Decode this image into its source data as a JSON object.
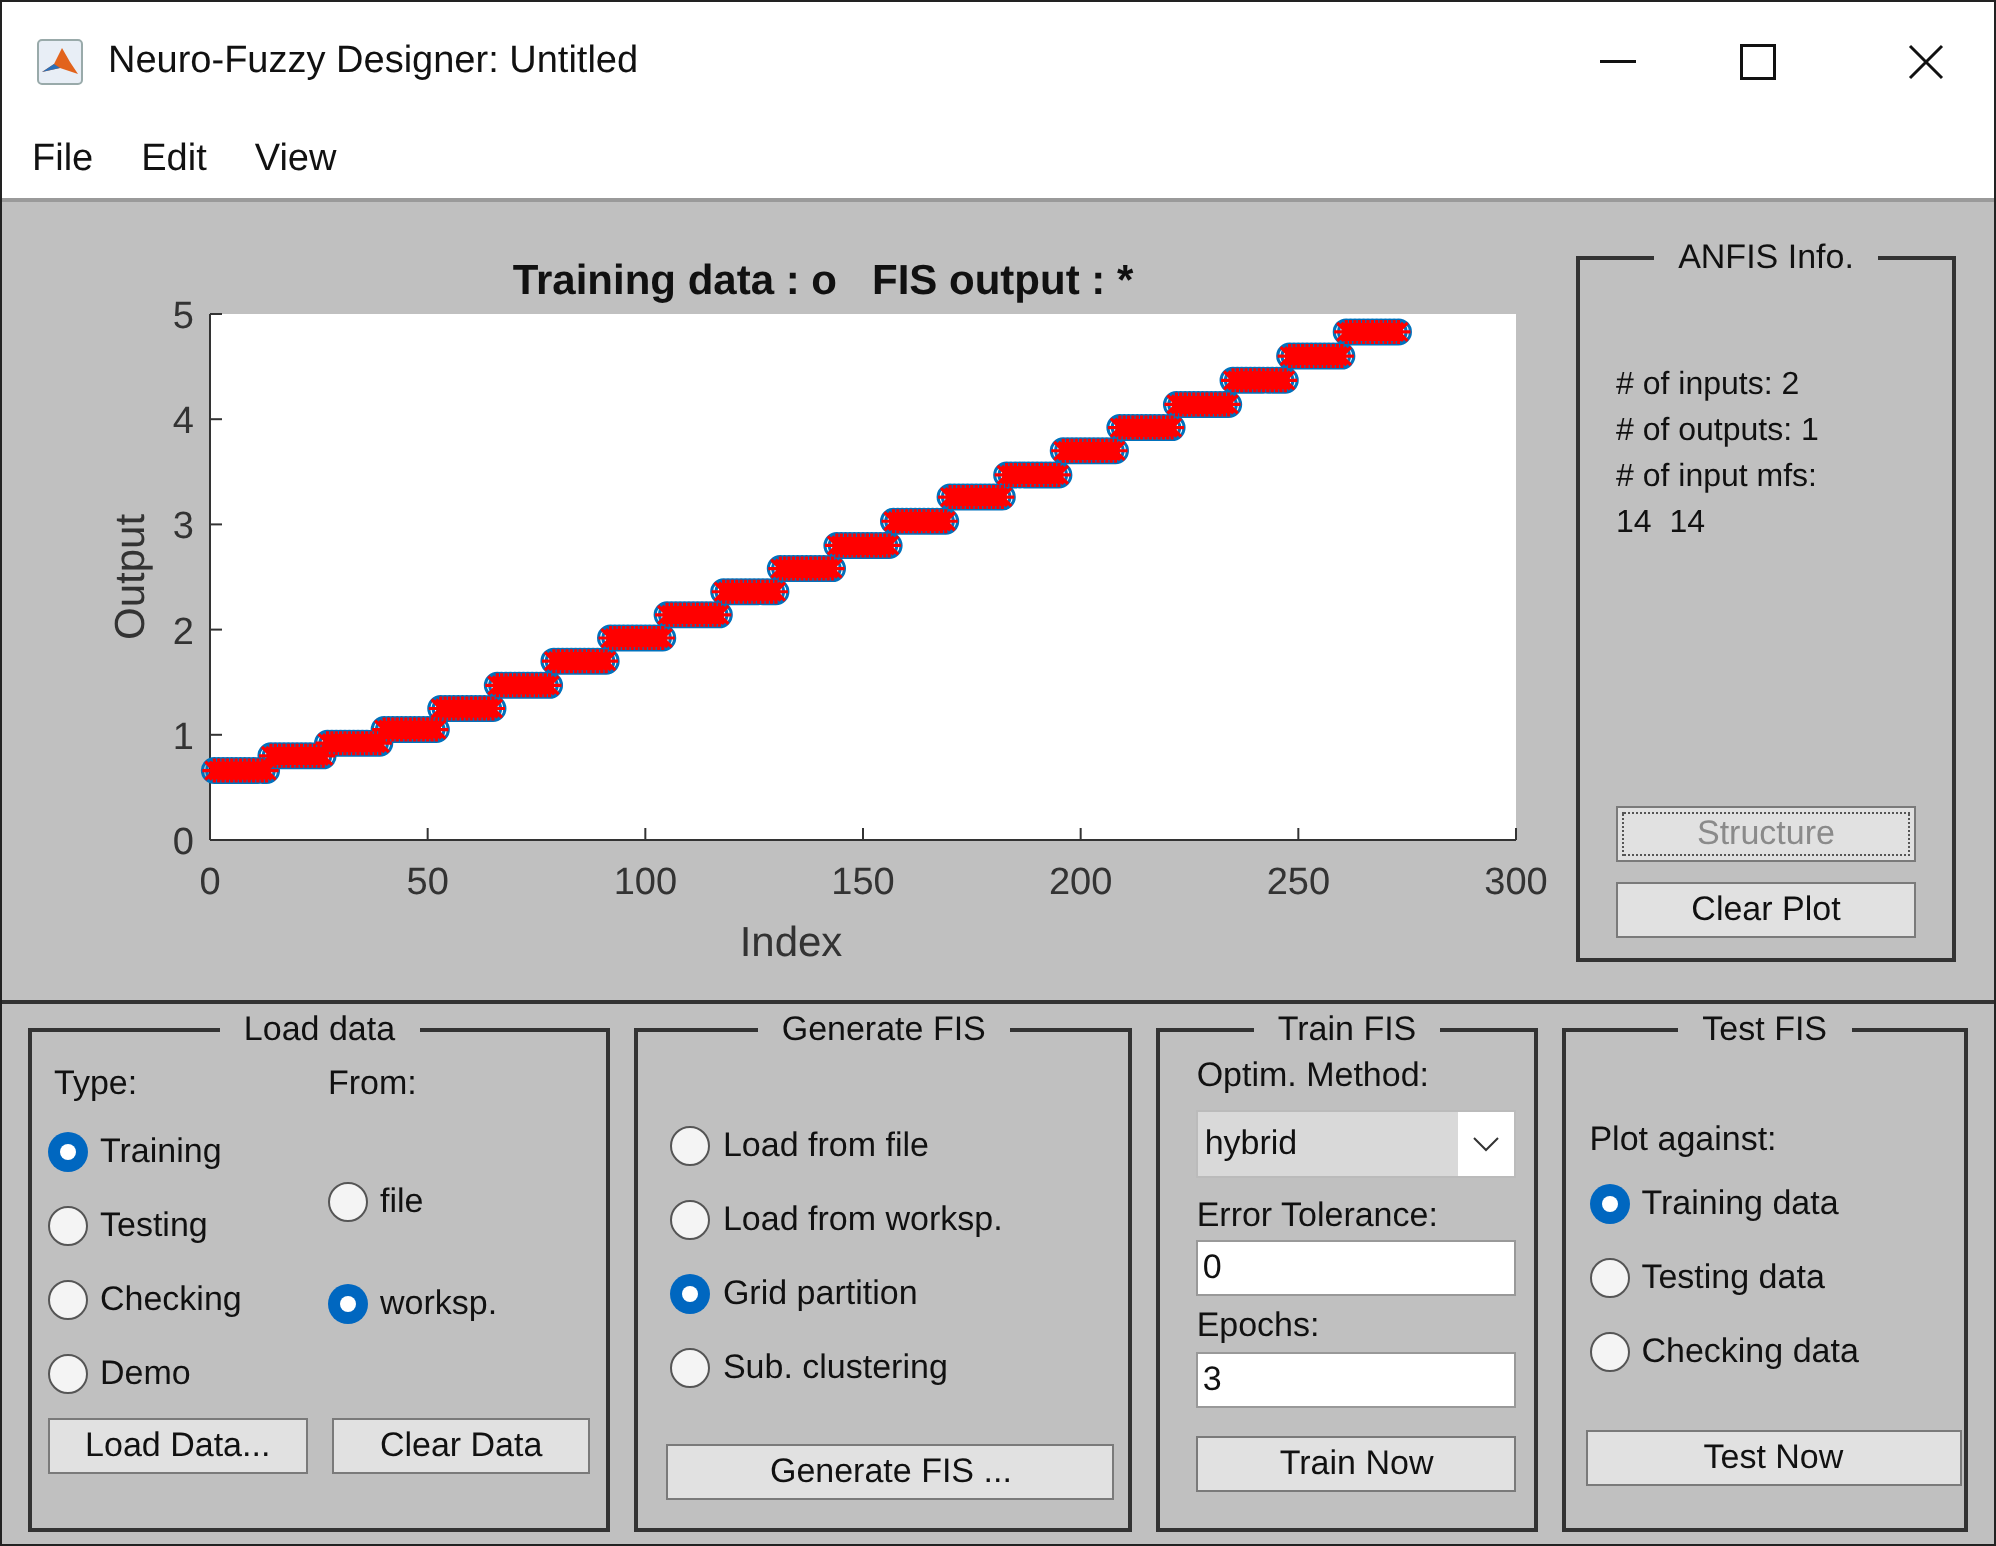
{
  "window": {
    "title": "Neuro-Fuzzy Designer: Untitled"
  },
  "menu": [
    "File",
    "Edit",
    "View"
  ],
  "plot": {
    "title": "Training data : o   FIS output : *",
    "xlabel": "Index",
    "ylabel": "Output",
    "xticks": [
      "0",
      "50",
      "100",
      "150",
      "200",
      "250",
      "300"
    ],
    "yticks": [
      "5",
      "4",
      "3",
      "2",
      "1",
      "0"
    ]
  },
  "anfis_info": {
    "title": "ANFIS Info.",
    "lines": [
      "# of inputs: 2",
      "# of outputs: 1",
      "# of input mfs:",
      "14  14"
    ],
    "buttons": [
      {
        "label": "Structure",
        "disabled": true
      },
      {
        "label": "Clear Plot",
        "disabled": false
      }
    ]
  },
  "load_data": {
    "title": "Load data",
    "type_label": "Type:",
    "from_label": "From:",
    "types": [
      {
        "label": "Training",
        "selected": true
      },
      {
        "label": "Testing",
        "selected": false
      },
      {
        "label": "Checking",
        "selected": false
      },
      {
        "label": "Demo",
        "selected": false
      }
    ],
    "sources": [
      {
        "label": "file",
        "selected": false
      },
      {
        "label": "worksp.",
        "selected": true
      }
    ],
    "buttons": [
      "Load Data...",
      "Clear Data"
    ]
  },
  "generate_fis": {
    "title": "Generate FIS",
    "options": [
      {
        "label": "Load from file",
        "selected": false
      },
      {
        "label": "Load from worksp.",
        "selected": false
      },
      {
        "label": "Grid partition",
        "selected": true
      },
      {
        "label": "Sub. clustering",
        "selected": false
      }
    ],
    "button": "Generate FIS ..."
  },
  "train_fis": {
    "title": "Train FIS",
    "method_label": "Optim. Method:",
    "method": "hybrid",
    "error_label": "Error Tolerance:",
    "error_tolerance": "0",
    "epochs_label": "Epochs:",
    "epochs": "3",
    "button": "Train Now"
  },
  "test_fis": {
    "title": "Test FIS",
    "label": "Plot against:",
    "options": [
      {
        "label": "Training data",
        "selected": true
      },
      {
        "label": "Testing data",
        "selected": false
      },
      {
        "label": "Checking data",
        "selected": false
      }
    ],
    "button": "Test Now"
  }
}
